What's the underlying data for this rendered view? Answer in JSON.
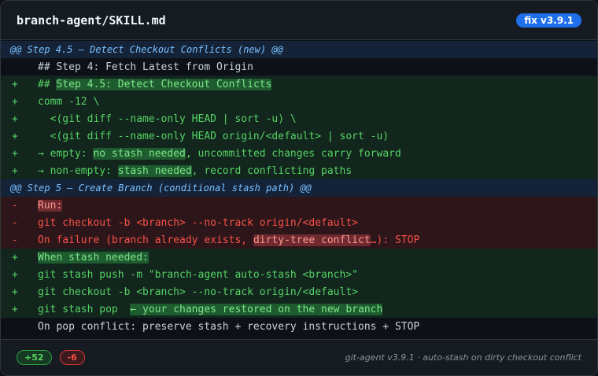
{
  "header": {
    "file_title": "branch-agent/SKILL.md",
    "version_badge": "fix v3.9.1"
  },
  "diff": {
    "lines": [
      {
        "type": "hunk",
        "segments": [
          {
            "t": "@@ Step 4.5 — Detect Checkout Conflicts (new) @@",
            "hl": false
          }
        ]
      },
      {
        "type": "ctx",
        "sign": "",
        "segments": [
          {
            "t": "## Step 4: Fetch Latest from Origin",
            "hl": false
          }
        ]
      },
      {
        "type": "add",
        "sign": "+",
        "segments": [
          {
            "t": "## ",
            "hl": false
          },
          {
            "t": "Step 4.5: Detect Checkout Conflicts",
            "hl": true
          }
        ]
      },
      {
        "type": "add",
        "sign": "+",
        "segments": [
          {
            "t": "comm -12 \\",
            "hl": false
          }
        ]
      },
      {
        "type": "add",
        "sign": "+",
        "segments": [
          {
            "t": "  <(git diff --name-only HEAD | sort -u) \\",
            "hl": false
          }
        ]
      },
      {
        "type": "add",
        "sign": "+",
        "segments": [
          {
            "t": "  <(git diff --name-only HEAD origin/<default> | sort -u)",
            "hl": false
          }
        ]
      },
      {
        "type": "add",
        "sign": "+",
        "segments": [
          {
            "t": "→ empty: ",
            "hl": false
          },
          {
            "t": "no stash needed",
            "hl": true
          },
          {
            "t": ", uncommitted changes carry forward",
            "hl": false
          }
        ]
      },
      {
        "type": "add",
        "sign": "+",
        "segments": [
          {
            "t": "→ non-empty: ",
            "hl": false
          },
          {
            "t": "stash needed",
            "hl": true
          },
          {
            "t": ", record conflicting paths",
            "hl": false
          }
        ]
      },
      {
        "type": "hunk",
        "segments": [
          {
            "t": "@@ Step 5 — Create Branch (conditional stash path) @@",
            "hl": false
          }
        ]
      },
      {
        "type": "del",
        "sign": "-",
        "segments": [
          {
            "t": "Run:",
            "hl": true
          }
        ]
      },
      {
        "type": "del",
        "sign": "-",
        "segments": [
          {
            "t": "git checkout -b <branch> --no-track origin/<default>",
            "hl": false
          }
        ]
      },
      {
        "type": "del",
        "sign": "-",
        "segments": [
          {
            "t": "On failure (branch already exists, ",
            "hl": false
          },
          {
            "t": "dirty-tree conflict",
            "hl": true
          },
          {
            "t": "…): STOP",
            "hl": false
          }
        ]
      },
      {
        "type": "add",
        "sign": "+",
        "segments": [
          {
            "t": "When stash needed:",
            "hl": true
          }
        ]
      },
      {
        "type": "add",
        "sign": "+",
        "segments": [
          {
            "t": "git stash push -m \"branch-agent auto-stash <branch>\"",
            "hl": false
          }
        ]
      },
      {
        "type": "add",
        "sign": "+",
        "segments": [
          {
            "t": "git checkout -b <branch> --no-track origin/<default>",
            "hl": false
          }
        ]
      },
      {
        "type": "add",
        "sign": "+",
        "segments": [
          {
            "t": "git stash pop  ",
            "hl": false
          },
          {
            "t": "← your changes restored on the new branch",
            "hl": true
          }
        ]
      },
      {
        "type": "ctx",
        "sign": "",
        "segments": [
          {
            "t": "On pop conflict: preserve stash + recovery instructions + STOP",
            "hl": false
          }
        ]
      }
    ]
  },
  "footer": {
    "additions": "+52",
    "deletions": "-6",
    "note": "git-agent v3.9.1 · auto-stash on dirty checkout conflict"
  }
}
